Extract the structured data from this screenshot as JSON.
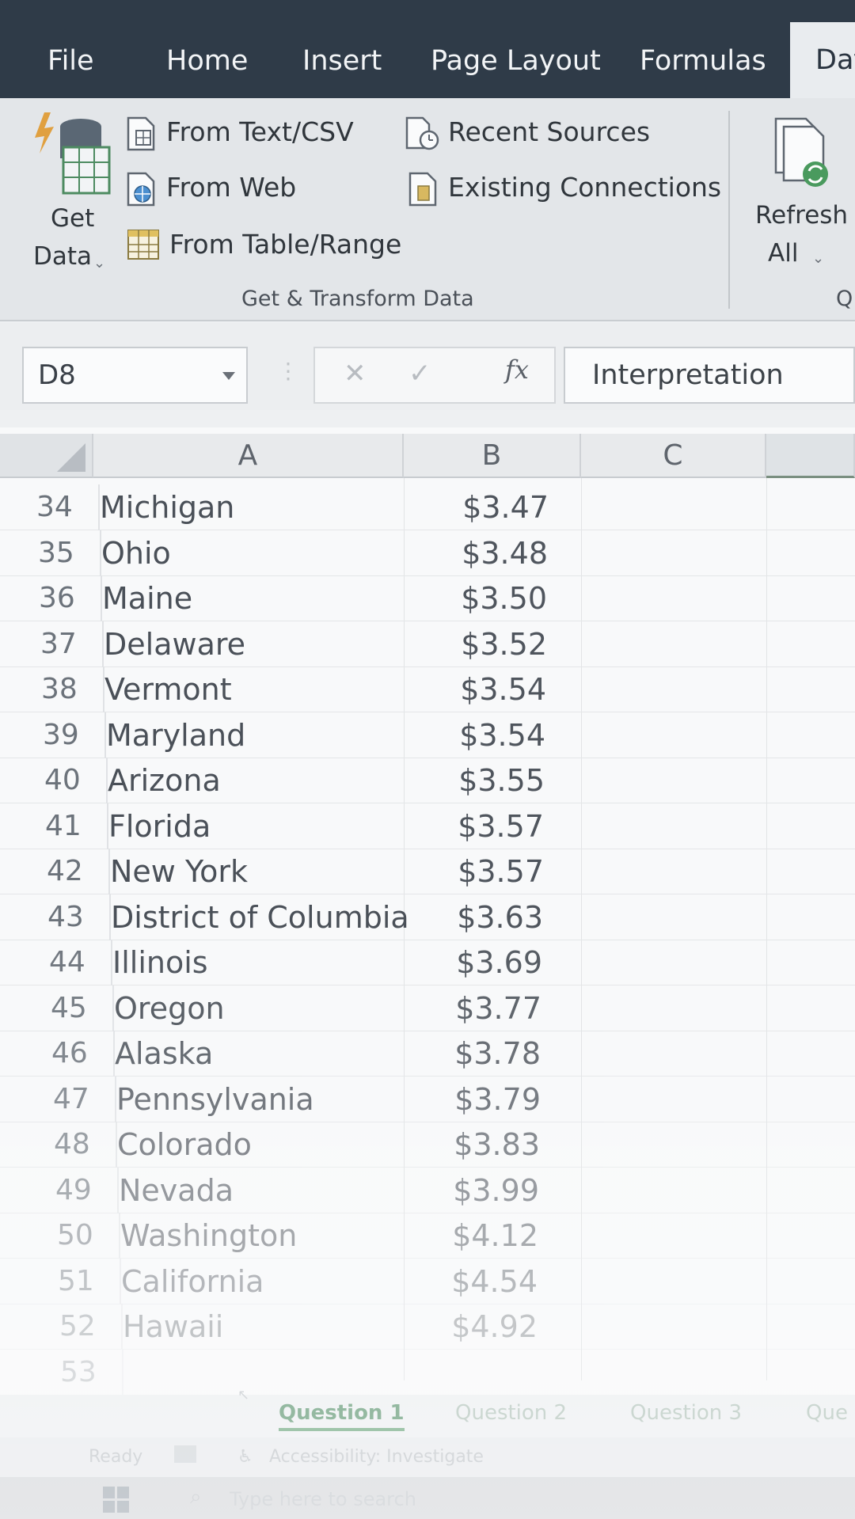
{
  "tabs": [
    "File",
    "Home",
    "Insert",
    "Page Layout",
    "Formulas",
    "Dat"
  ],
  "ribbon": {
    "get_data_line1": "Get",
    "get_data_line2": "Data",
    "from_text_csv": "From Text/CSV",
    "from_web": "From Web",
    "from_table_range": "From Table/Range",
    "recent_sources": "Recent Sources",
    "existing_connections": "Existing Connections",
    "group_label": "Get & Transform Data",
    "refresh_line1": "Refresh",
    "refresh_line2": "All",
    "next_group_label": "Q"
  },
  "formula_bar": {
    "name_box": "D8",
    "fx_label": "fx",
    "content": "Interpretation"
  },
  "columns": [
    "A",
    "B",
    "C"
  ],
  "rows": [
    {
      "num": "34",
      "state": "Michigan",
      "price": "$3.47"
    },
    {
      "num": "35",
      "state": "Ohio",
      "price": "$3.48"
    },
    {
      "num": "36",
      "state": "Maine",
      "price": "$3.50"
    },
    {
      "num": "37",
      "state": "Delaware",
      "price": "$3.52"
    },
    {
      "num": "38",
      "state": "Vermont",
      "price": "$3.54"
    },
    {
      "num": "39",
      "state": "Maryland",
      "price": "$3.54"
    },
    {
      "num": "40",
      "state": "Arizona",
      "price": "$3.55"
    },
    {
      "num": "41",
      "state": "Florida",
      "price": "$3.57"
    },
    {
      "num": "42",
      "state": "New York",
      "price": "$3.57"
    },
    {
      "num": "43",
      "state": "District of Columbia",
      "price": "$3.63"
    },
    {
      "num": "44",
      "state": "Illinois",
      "price": "$3.69"
    },
    {
      "num": "45",
      "state": "Oregon",
      "price": "$3.77"
    },
    {
      "num": "46",
      "state": "Alaska",
      "price": "$3.78"
    },
    {
      "num": "47",
      "state": "Pennsylvania",
      "price": "$3.79"
    },
    {
      "num": "48",
      "state": "Colorado",
      "price": "$3.83"
    },
    {
      "num": "49",
      "state": "Nevada",
      "price": "$3.99"
    },
    {
      "num": "50",
      "state": "Washington",
      "price": "$4.12"
    },
    {
      "num": "51",
      "state": "California",
      "price": "$4.54"
    },
    {
      "num": "52",
      "state": "Hawaii",
      "price": "$4.92"
    },
    {
      "num": "53",
      "state": "",
      "price": ""
    }
  ],
  "sheet_tabs": [
    "Question 1",
    "Question 2",
    "Question 3",
    "Que"
  ],
  "status": {
    "ready": "Ready",
    "accessibility": "Accessibility: Investigate",
    "search_placeholder": "Type here to search"
  },
  "colors": {
    "tab_bar": "#2f3b48",
    "active_sheet_tab": "#6d9f7e"
  }
}
